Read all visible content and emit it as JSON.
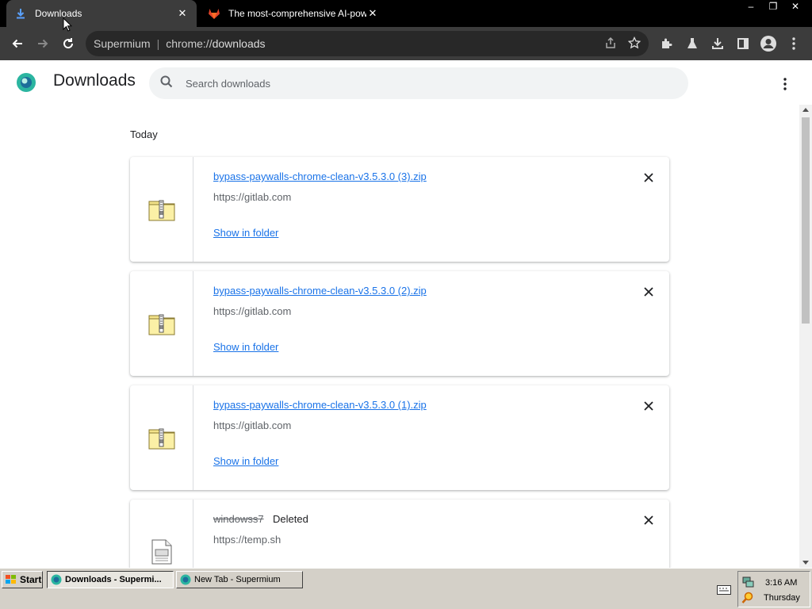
{
  "browser": {
    "tabs": [
      {
        "title": "Downloads",
        "favicon": "download-icon",
        "active": true
      },
      {
        "title": "The most-comprehensive AI-powered",
        "favicon": "gitlab-icon",
        "active": false
      }
    ],
    "omnibox": {
      "app_name": "Supermium",
      "separator": "|",
      "scheme": "chrome://",
      "path": "downloads"
    },
    "window_controls": {
      "minimize": "–",
      "restore": "❐",
      "close": "✕"
    }
  },
  "page": {
    "title": "Downloads",
    "search_placeholder": "Search downloads",
    "section_label": "Today",
    "items": [
      {
        "filename": "bypass-paywalls-chrome-clean-v3.5.3.0 (3).zip",
        "source": "https://gitlab.com",
        "action": "Show in folder",
        "deleted": false
      },
      {
        "filename": "bypass-paywalls-chrome-clean-v3.5.3.0 (2).zip",
        "source": "https://gitlab.com",
        "action": "Show in folder",
        "deleted": false
      },
      {
        "filename": "bypass-paywalls-chrome-clean-v3.5.3.0 (1).zip",
        "source": "https://gitlab.com",
        "action": "Show in folder",
        "deleted": false
      },
      {
        "filename": "windowss7",
        "status": "Deleted",
        "source": "https://temp.sh",
        "deleted": true
      }
    ]
  },
  "taskbar": {
    "start_label": "Start",
    "tasks": [
      {
        "label": "Downloads - Supermi...",
        "active": true
      },
      {
        "label": "New Tab - Supermium",
        "active": false
      }
    ],
    "clock": {
      "time": "3:16 AM",
      "day": "Thursday"
    }
  },
  "colors": {
    "accent": "#1a73e8",
    "tab_strip": "#000000",
    "toolbar": "#3c3c3c",
    "taskbar": "#d4d0c8"
  }
}
